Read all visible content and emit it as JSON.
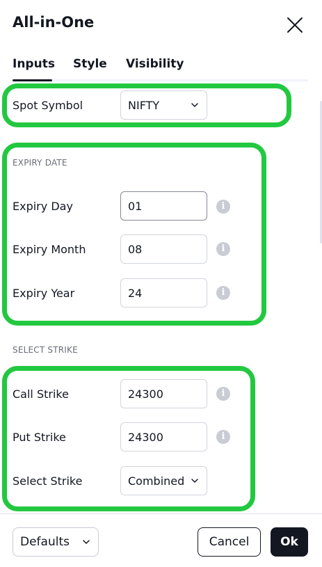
{
  "dialog": {
    "title": "All-in-One",
    "close_icon": "close-icon"
  },
  "tabs": [
    {
      "label": "Inputs",
      "active": true
    },
    {
      "label": "Style",
      "active": false
    },
    {
      "label": "Visibility",
      "active": false
    }
  ],
  "spot": {
    "label": "Spot Symbol",
    "value": "NIFTY"
  },
  "expiry": {
    "header": "EXPIRY DATE",
    "day_label": "Expiry Day",
    "day_value": "01",
    "month_label": "Expiry Month",
    "month_value": "08",
    "year_label": "Expiry Year",
    "year_value": "24"
  },
  "strike": {
    "header": "SELECT STRIKE",
    "call_label": "Call Strike",
    "call_value": "24300",
    "put_label": "Put Strike",
    "put_value": "24300",
    "select_label": "Select Strike",
    "select_value": "Combined"
  },
  "footer": {
    "defaults_label": "Defaults",
    "cancel_label": "Cancel",
    "ok_label": "Ok"
  },
  "colors": {
    "highlight": "#22c840",
    "primary": "#131722",
    "info_icon": "#c9ccd3"
  }
}
